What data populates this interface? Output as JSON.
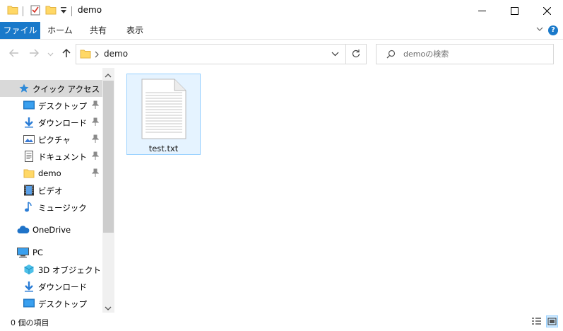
{
  "window": {
    "title": "demo"
  },
  "ribbon": {
    "tabs": [
      "ファイル",
      "ホーム",
      "共有",
      "表示"
    ]
  },
  "address": {
    "path": "demo"
  },
  "search": {
    "placeholder": "demoの検索"
  },
  "nav": {
    "quick_access": "クイック アクセス",
    "quick_items": [
      "デスクトップ",
      "ダウンロード",
      "ピクチャ",
      "ドキュメント",
      "demo",
      "ビデオ",
      "ミュージック"
    ],
    "onedrive": "OneDrive",
    "pc": "PC",
    "pc_items": [
      "3D オブジェクト",
      "ダウンロード",
      "デスクトップ"
    ]
  },
  "files": [
    {
      "name": "test.txt"
    }
  ],
  "status": {
    "text": "0 個の項目"
  },
  "colors": {
    "accent": "#1979ca",
    "selection": "#cce8ff",
    "selection_border": "#99d1ff",
    "folder": "#ffd866"
  }
}
